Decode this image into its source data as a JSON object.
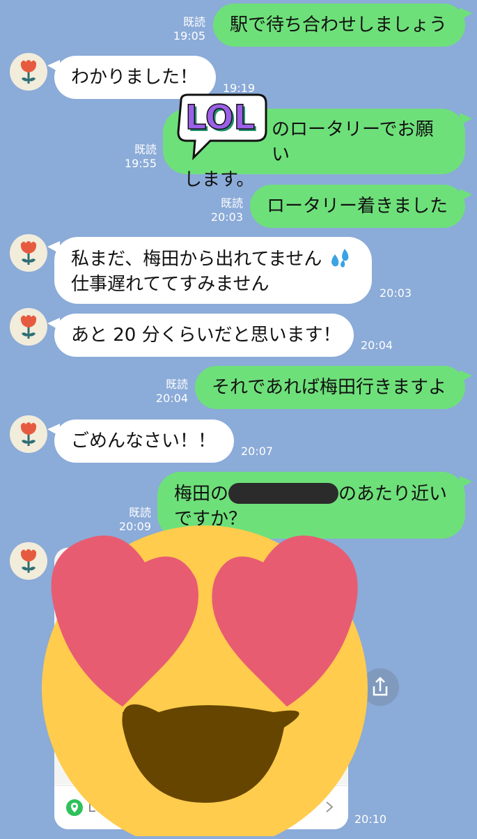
{
  "read_label": "既読",
  "messages": [
    {
      "id": "m1",
      "side": "out",
      "text": "駅で待ち合わせしましょう",
      "time": "19:05",
      "read": true
    },
    {
      "id": "m2",
      "side": "in",
      "text": "わかりました！",
      "time": "19:19"
    },
    {
      "id": "m3",
      "side": "out",
      "text_line1": "のロータリーでお願い",
      "text_line2": "します。",
      "time": "19:55",
      "read": true
    },
    {
      "id": "m4",
      "side": "out",
      "text": "ロータリー着きました",
      "time": "20:03",
      "read": true
    },
    {
      "id": "m5",
      "side": "in",
      "text_line1": "私まだ、梅田から出れてません",
      "text_line2": "仕事遅れててすみません",
      "time": "20:03"
    },
    {
      "id": "m6",
      "side": "in",
      "text": "あと 20 分くらいだと思います！",
      "time": "20:04"
    },
    {
      "id": "m7",
      "side": "out",
      "text": "それであれば梅田行きますよ",
      "time": "20:04",
      "read": true
    },
    {
      "id": "m8",
      "side": "in",
      "text": "ごめんなさい！！",
      "time": "20:07"
    },
    {
      "id": "m9",
      "side": "out",
      "text_prefix": "梅田の",
      "text_suffix": "のあたり近い",
      "text_line2": "ですか？",
      "time": "20:09",
      "read": true
    }
  ],
  "location_card": {
    "footer_label": "Lo",
    "time": "20:10"
  },
  "stickers": {
    "lol_text": "LOL"
  },
  "colors": {
    "background": "#8babd8",
    "outgoing": "#6ee07a",
    "incoming": "#ffffff",
    "lol_purple": "#9b5fe8",
    "heart": "#e85c72",
    "face": "#ffcc4d"
  }
}
